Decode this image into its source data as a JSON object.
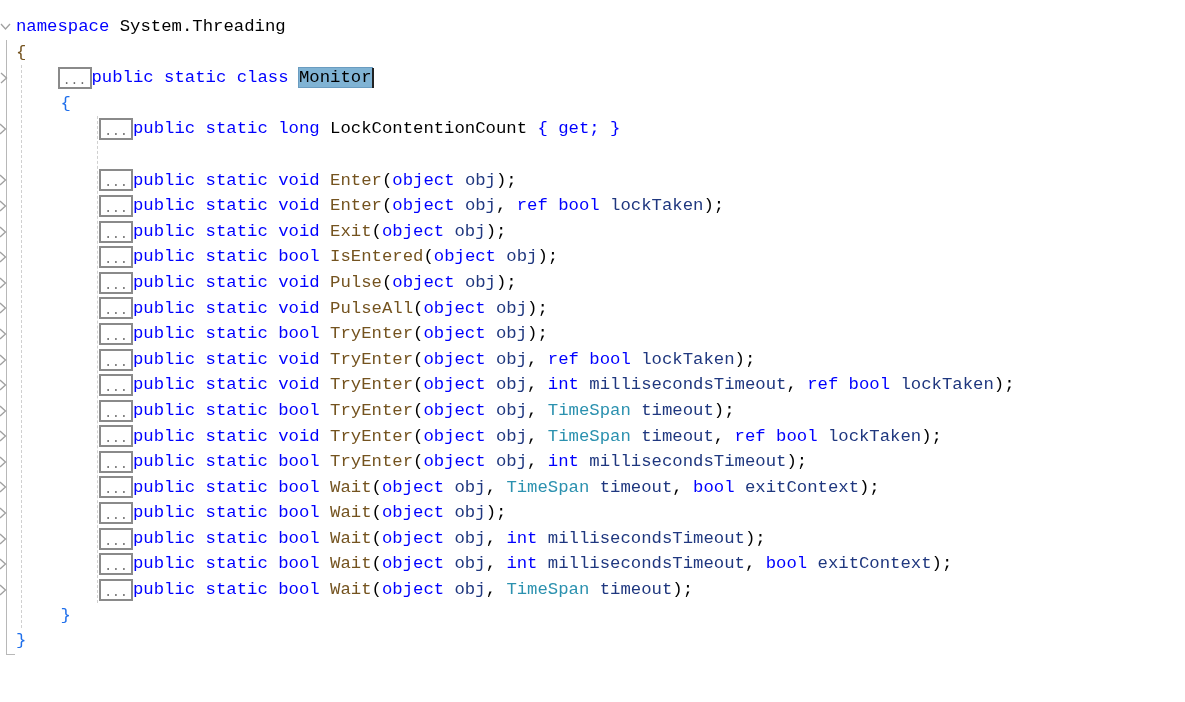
{
  "editor": {
    "root": {
      "kind": "block",
      "collapsed": false,
      "tokens": [
        {
          "kind": "kw",
          "text": "namespace "
        },
        {
          "kind": "name",
          "text": "System.Threading"
        }
      ],
      "open": "{",
      "close": "}",
      "children": [
        {
          "kind": "block",
          "collapsed": true,
          "marker": "...",
          "tokens": [
            {
              "kind": "kw",
              "text": "public static class "
            },
            {
              "kind": "name",
              "text": "Monitor",
              "selected": true
            }
          ],
          "open": "{",
          "close": "}",
          "children": [
            {
              "kind": "member",
              "collapsed": true,
              "marker": "...",
              "tokens": [
                {
                  "kind": "kw",
                  "text": "public static long "
                },
                {
                  "kind": "name",
                  "text": "LockContentionCount "
                },
                {
                  "kind": "kw",
                  "text": "{ get; }"
                }
              ]
            },
            {
              "kind": "blank"
            },
            {
              "kind": "member",
              "collapsed": true,
              "marker": "...",
              "tokens": [
                {
                  "kind": "kw",
                  "text": "public static void "
                },
                {
                  "kind": "method",
                  "text": "Enter"
                },
                {
                  "kind": "punct",
                  "text": "("
                },
                {
                  "kind": "kw",
                  "text": "object "
                },
                {
                  "kind": "param",
                  "text": "obj"
                },
                {
                  "kind": "punct",
                  "text": ");"
                }
              ]
            },
            {
              "kind": "member",
              "collapsed": true,
              "marker": "...",
              "tokens": [
                {
                  "kind": "kw",
                  "text": "public static void "
                },
                {
                  "kind": "method",
                  "text": "Enter"
                },
                {
                  "kind": "punct",
                  "text": "("
                },
                {
                  "kind": "kw",
                  "text": "object "
                },
                {
                  "kind": "param",
                  "text": "obj"
                },
                {
                  "kind": "punct",
                  "text": ", "
                },
                {
                  "kind": "kw",
                  "text": "ref bool "
                },
                {
                  "kind": "param",
                  "text": "lockTaken"
                },
                {
                  "kind": "punct",
                  "text": ");"
                }
              ]
            },
            {
              "kind": "member",
              "collapsed": true,
              "marker": "...",
              "tokens": [
                {
                  "kind": "kw",
                  "text": "public static void "
                },
                {
                  "kind": "method",
                  "text": "Exit"
                },
                {
                  "kind": "punct",
                  "text": "("
                },
                {
                  "kind": "kw",
                  "text": "object "
                },
                {
                  "kind": "param",
                  "text": "obj"
                },
                {
                  "kind": "punct",
                  "text": ");"
                }
              ]
            },
            {
              "kind": "member",
              "collapsed": true,
              "marker": "...",
              "tokens": [
                {
                  "kind": "kw",
                  "text": "public static bool "
                },
                {
                  "kind": "method",
                  "text": "IsEntered"
                },
                {
                  "kind": "punct",
                  "text": "("
                },
                {
                  "kind": "kw",
                  "text": "object "
                },
                {
                  "kind": "param",
                  "text": "obj"
                },
                {
                  "kind": "punct",
                  "text": ");"
                }
              ]
            },
            {
              "kind": "member",
              "collapsed": true,
              "marker": "...",
              "tokens": [
                {
                  "kind": "kw",
                  "text": "public static void "
                },
                {
                  "kind": "method",
                  "text": "Pulse"
                },
                {
                  "kind": "punct",
                  "text": "("
                },
                {
                  "kind": "kw",
                  "text": "object "
                },
                {
                  "kind": "param",
                  "text": "obj"
                },
                {
                  "kind": "punct",
                  "text": ");"
                }
              ]
            },
            {
              "kind": "member",
              "collapsed": true,
              "marker": "...",
              "tokens": [
                {
                  "kind": "kw",
                  "text": "public static void "
                },
                {
                  "kind": "method",
                  "text": "PulseAll"
                },
                {
                  "kind": "punct",
                  "text": "("
                },
                {
                  "kind": "kw",
                  "text": "object "
                },
                {
                  "kind": "param",
                  "text": "obj"
                },
                {
                  "kind": "punct",
                  "text": ");"
                }
              ]
            },
            {
              "kind": "member",
              "collapsed": true,
              "marker": "...",
              "tokens": [
                {
                  "kind": "kw",
                  "text": "public static bool "
                },
                {
                  "kind": "method",
                  "text": "TryEnter"
                },
                {
                  "kind": "punct",
                  "text": "("
                },
                {
                  "kind": "kw",
                  "text": "object "
                },
                {
                  "kind": "param",
                  "text": "obj"
                },
                {
                  "kind": "punct",
                  "text": ");"
                }
              ]
            },
            {
              "kind": "member",
              "collapsed": true,
              "marker": "...",
              "tokens": [
                {
                  "kind": "kw",
                  "text": "public static void "
                },
                {
                  "kind": "method",
                  "text": "TryEnter"
                },
                {
                  "kind": "punct",
                  "text": "("
                },
                {
                  "kind": "kw",
                  "text": "object "
                },
                {
                  "kind": "param",
                  "text": "obj"
                },
                {
                  "kind": "punct",
                  "text": ", "
                },
                {
                  "kind": "kw",
                  "text": "ref bool "
                },
                {
                  "kind": "param",
                  "text": "lockTaken"
                },
                {
                  "kind": "punct",
                  "text": ");"
                }
              ]
            },
            {
              "kind": "member",
              "collapsed": true,
              "marker": "...",
              "tokens": [
                {
                  "kind": "kw",
                  "text": "public static void "
                },
                {
                  "kind": "method",
                  "text": "TryEnter"
                },
                {
                  "kind": "punct",
                  "text": "("
                },
                {
                  "kind": "kw",
                  "text": "object "
                },
                {
                  "kind": "param",
                  "text": "obj"
                },
                {
                  "kind": "punct",
                  "text": ", "
                },
                {
                  "kind": "kw",
                  "text": "int "
                },
                {
                  "kind": "param",
                  "text": "millisecondsTimeout"
                },
                {
                  "kind": "punct",
                  "text": ", "
                },
                {
                  "kind": "kw",
                  "text": "ref bool "
                },
                {
                  "kind": "param",
                  "text": "lockTaken"
                },
                {
                  "kind": "punct",
                  "text": ");"
                }
              ]
            },
            {
              "kind": "member",
              "collapsed": true,
              "marker": "...",
              "tokens": [
                {
                  "kind": "kw",
                  "text": "public static bool "
                },
                {
                  "kind": "method",
                  "text": "TryEnter"
                },
                {
                  "kind": "punct",
                  "text": "("
                },
                {
                  "kind": "kw",
                  "text": "object "
                },
                {
                  "kind": "param",
                  "text": "obj"
                },
                {
                  "kind": "punct",
                  "text": ", "
                },
                {
                  "kind": "type",
                  "text": "TimeSpan "
                },
                {
                  "kind": "param",
                  "text": "timeout"
                },
                {
                  "kind": "punct",
                  "text": ");"
                }
              ]
            },
            {
              "kind": "member",
              "collapsed": true,
              "marker": "...",
              "tokens": [
                {
                  "kind": "kw",
                  "text": "public static void "
                },
                {
                  "kind": "method",
                  "text": "TryEnter"
                },
                {
                  "kind": "punct",
                  "text": "("
                },
                {
                  "kind": "kw",
                  "text": "object "
                },
                {
                  "kind": "param",
                  "text": "obj"
                },
                {
                  "kind": "punct",
                  "text": ", "
                },
                {
                  "kind": "type",
                  "text": "TimeSpan "
                },
                {
                  "kind": "param",
                  "text": "timeout"
                },
                {
                  "kind": "punct",
                  "text": ", "
                },
                {
                  "kind": "kw",
                  "text": "ref bool "
                },
                {
                  "kind": "param",
                  "text": "lockTaken"
                },
                {
                  "kind": "punct",
                  "text": ");"
                }
              ]
            },
            {
              "kind": "member",
              "collapsed": true,
              "marker": "...",
              "tokens": [
                {
                  "kind": "kw",
                  "text": "public static bool "
                },
                {
                  "kind": "method",
                  "text": "TryEnter"
                },
                {
                  "kind": "punct",
                  "text": "("
                },
                {
                  "kind": "kw",
                  "text": "object "
                },
                {
                  "kind": "param",
                  "text": "obj"
                },
                {
                  "kind": "punct",
                  "text": ", "
                },
                {
                  "kind": "kw",
                  "text": "int "
                },
                {
                  "kind": "param",
                  "text": "millisecondsTimeout"
                },
                {
                  "kind": "punct",
                  "text": ");"
                }
              ]
            },
            {
              "kind": "member",
              "collapsed": true,
              "marker": "...",
              "tokens": [
                {
                  "kind": "kw",
                  "text": "public static bool "
                },
                {
                  "kind": "method",
                  "text": "Wait"
                },
                {
                  "kind": "punct",
                  "text": "("
                },
                {
                  "kind": "kw",
                  "text": "object "
                },
                {
                  "kind": "param",
                  "text": "obj"
                },
                {
                  "kind": "punct",
                  "text": ", "
                },
                {
                  "kind": "type",
                  "text": "TimeSpan "
                },
                {
                  "kind": "param",
                  "text": "timeout"
                },
                {
                  "kind": "punct",
                  "text": ", "
                },
                {
                  "kind": "kw",
                  "text": "bool "
                },
                {
                  "kind": "param",
                  "text": "exitContext"
                },
                {
                  "kind": "punct",
                  "text": ");"
                }
              ]
            },
            {
              "kind": "member",
              "collapsed": true,
              "marker": "...",
              "tokens": [
                {
                  "kind": "kw",
                  "text": "public static bool "
                },
                {
                  "kind": "method",
                  "text": "Wait"
                },
                {
                  "kind": "punct",
                  "text": "("
                },
                {
                  "kind": "kw",
                  "text": "object "
                },
                {
                  "kind": "param",
                  "text": "obj"
                },
                {
                  "kind": "punct",
                  "text": ");"
                }
              ]
            },
            {
              "kind": "member",
              "collapsed": true,
              "marker": "...",
              "tokens": [
                {
                  "kind": "kw",
                  "text": "public static bool "
                },
                {
                  "kind": "method",
                  "text": "Wait"
                },
                {
                  "kind": "punct",
                  "text": "("
                },
                {
                  "kind": "kw",
                  "text": "object "
                },
                {
                  "kind": "param",
                  "text": "obj"
                },
                {
                  "kind": "punct",
                  "text": ", "
                },
                {
                  "kind": "kw",
                  "text": "int "
                },
                {
                  "kind": "param",
                  "text": "millisecondsTimeout"
                },
                {
                  "kind": "punct",
                  "text": ");"
                }
              ]
            },
            {
              "kind": "member",
              "collapsed": true,
              "marker": "...",
              "tokens": [
                {
                  "kind": "kw",
                  "text": "public static bool "
                },
                {
                  "kind": "method",
                  "text": "Wait"
                },
                {
                  "kind": "punct",
                  "text": "("
                },
                {
                  "kind": "kw",
                  "text": "object "
                },
                {
                  "kind": "param",
                  "text": "obj"
                },
                {
                  "kind": "punct",
                  "text": ", "
                },
                {
                  "kind": "kw",
                  "text": "int "
                },
                {
                  "kind": "param",
                  "text": "millisecondsTimeout"
                },
                {
                  "kind": "punct",
                  "text": ", "
                },
                {
                  "kind": "kw",
                  "text": "bool "
                },
                {
                  "kind": "param",
                  "text": "exitContext"
                },
                {
                  "kind": "punct",
                  "text": ");"
                }
              ]
            },
            {
              "kind": "member",
              "collapsed": true,
              "marker": "...",
              "tokens": [
                {
                  "kind": "kw",
                  "text": "public static bool "
                },
                {
                  "kind": "method",
                  "text": "Wait"
                },
                {
                  "kind": "punct",
                  "text": "("
                },
                {
                  "kind": "kw",
                  "text": "object "
                },
                {
                  "kind": "param",
                  "text": "obj"
                },
                {
                  "kind": "punct",
                  "text": ", "
                },
                {
                  "kind": "type",
                  "text": "TimeSpan "
                },
                {
                  "kind": "param",
                  "text": "timeout"
                },
                {
                  "kind": "punct",
                  "text": ");"
                }
              ]
            }
          ]
        }
      ]
    }
  }
}
